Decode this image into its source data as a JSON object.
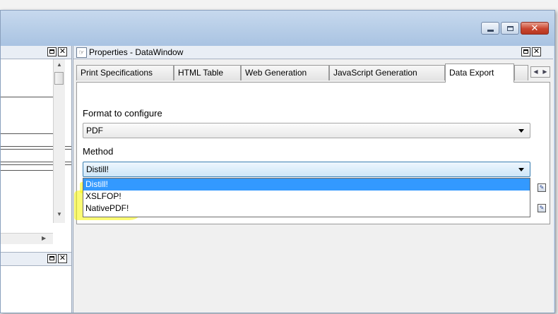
{
  "window": {
    "close_glyph": "✕"
  },
  "left_pane": {
    "close_glyph": "✕"
  },
  "properties": {
    "title": "Properties - DataWindow",
    "close_glyph": "✕",
    "tabs": [
      {
        "label": "Print Specifications"
      },
      {
        "label": "HTML Table"
      },
      {
        "label": "Web Generation"
      },
      {
        "label": "JavaScript Generation"
      },
      {
        "label": "Data Export",
        "active": true
      }
    ],
    "format_label": "Format to configure",
    "format_value": "PDF",
    "method_label": "Method",
    "method_value": "Distill!",
    "method_options": [
      "Distill!",
      "XSLFOP!",
      "NativePDF!"
    ],
    "method_selected_index": 0
  },
  "colors": {
    "highlight": "#f7f700",
    "selection": "#3399ff",
    "focus_border": "#3c7fb1"
  }
}
